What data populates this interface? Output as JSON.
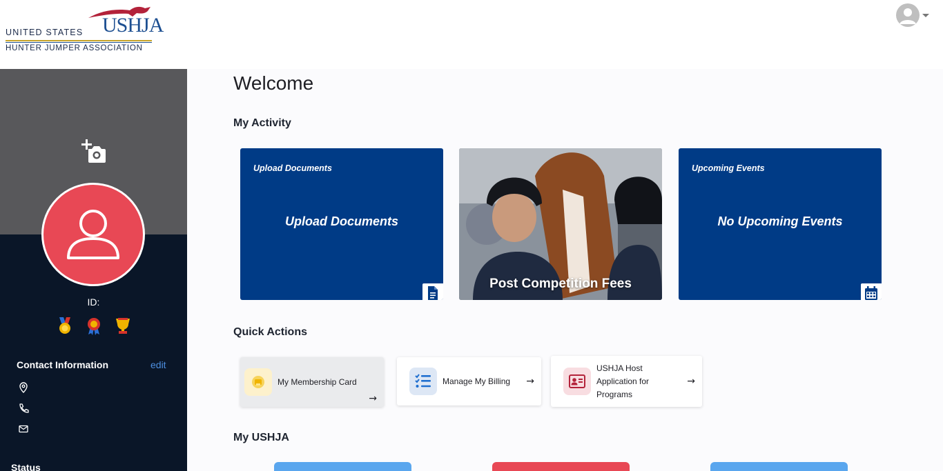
{
  "header": {
    "logo_line1": "UNITED STATES",
    "logo_line2": "HUNTER JUMPER ASSOCIATION",
    "logo_mark": "USHJA"
  },
  "sidebar": {
    "id_label": "ID:",
    "contact_title": "Contact Information",
    "edit_label": "edit",
    "status_title": "Status",
    "icons": [
      "add-photo-icon",
      "user-icon",
      "medal-icon",
      "ribbon-icon",
      "trophy-icon",
      "location-icon",
      "phone-icon",
      "mail-icon"
    ]
  },
  "main": {
    "welcome": "Welcome",
    "my_activity": "My Activity",
    "cards": [
      {
        "small": "Upload Documents",
        "big": "Upload Documents"
      },
      {
        "caption": "Post Competition Fees"
      },
      {
        "small": "Upcoming Events",
        "big": "No Upcoming Events"
      }
    ],
    "quick_actions_title": "Quick Actions",
    "quick_actions": [
      {
        "label": "My Membership Card"
      },
      {
        "label": "Manage My Billing"
      },
      {
        "label": "USHJA Host Application for Programs"
      }
    ],
    "my_ushja_title": "My USHJA"
  },
  "colors": {
    "brand_blue": "#003b86",
    "sidebar_bg": "#0a1628",
    "profile_red": "#e84855",
    "link_blue": "#4d8fe0"
  }
}
